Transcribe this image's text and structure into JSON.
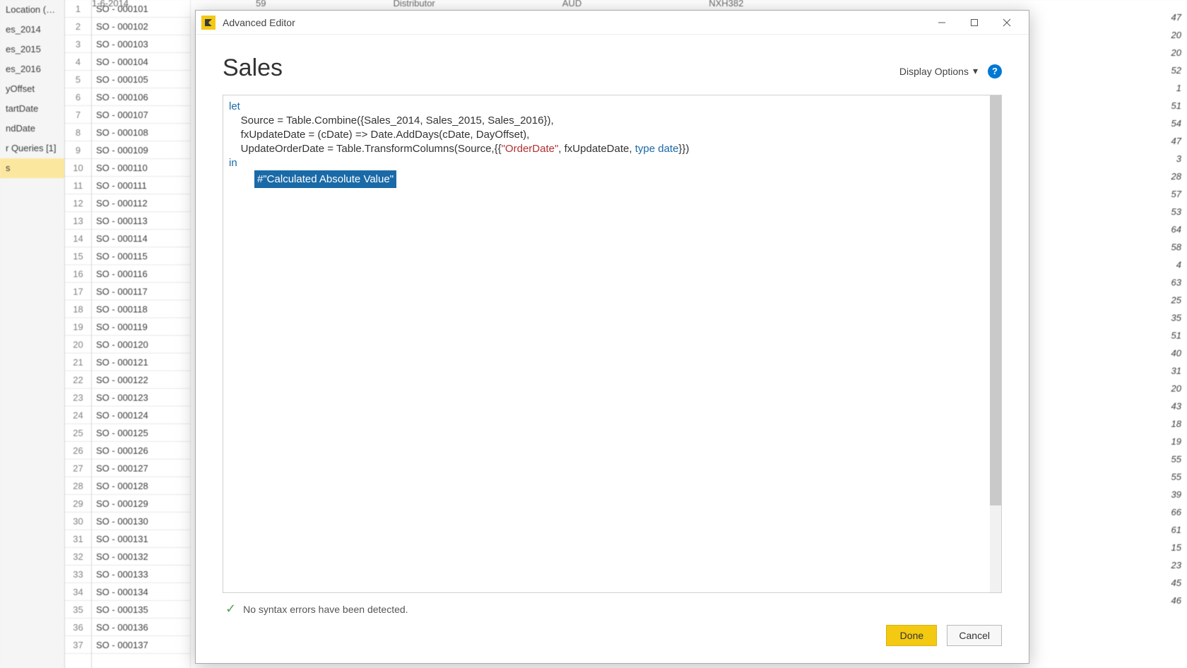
{
  "bg": {
    "queries": [
      "Location (C:\\…",
      "es_2014",
      "es_2015",
      "es_2016",
      "yOffset",
      "tartDate",
      "ndDate",
      "r Queries [1]",
      "s"
    ],
    "header_cells": [
      "1-6-2014",
      "59",
      "Distributor",
      "AUD",
      "NXH382"
    ],
    "rows": [
      {
        "n": 1,
        "so": "SO - 000101",
        "r": 47
      },
      {
        "n": 2,
        "so": "SO - 000102",
        "r": 20
      },
      {
        "n": 3,
        "so": "SO - 000103",
        "r": 20
      },
      {
        "n": 4,
        "so": "SO - 000104",
        "r": 52
      },
      {
        "n": 5,
        "so": "SO - 000105",
        "r": 1
      },
      {
        "n": 6,
        "so": "SO - 000106",
        "r": 51
      },
      {
        "n": 7,
        "so": "SO - 000107",
        "r": 54
      },
      {
        "n": 8,
        "so": "SO - 000108",
        "r": 47
      },
      {
        "n": 9,
        "so": "SO - 000109",
        "r": 3
      },
      {
        "n": 10,
        "so": "SO - 000110",
        "r": 28
      },
      {
        "n": 11,
        "so": "SO - 000111",
        "r": 57
      },
      {
        "n": 12,
        "so": "SO - 000112",
        "r": 53
      },
      {
        "n": 13,
        "so": "SO - 000113",
        "r": 64
      },
      {
        "n": 14,
        "so": "SO - 000114",
        "r": 58
      },
      {
        "n": 15,
        "so": "SO - 000115",
        "r": 4
      },
      {
        "n": 16,
        "so": "SO - 000116",
        "r": 63
      },
      {
        "n": 17,
        "so": "SO - 000117",
        "r": 25
      },
      {
        "n": 18,
        "so": "SO - 000118",
        "r": 35
      },
      {
        "n": 19,
        "so": "SO - 000119",
        "r": 51
      },
      {
        "n": 20,
        "so": "SO - 000120",
        "r": 40
      },
      {
        "n": 21,
        "so": "SO - 000121",
        "r": 31
      },
      {
        "n": 22,
        "so": "SO - 000122",
        "r": 20
      },
      {
        "n": 23,
        "so": "SO - 000123",
        "r": 43
      },
      {
        "n": 24,
        "so": "SO - 000124",
        "r": 18
      },
      {
        "n": 25,
        "so": "SO - 000125",
        "r": 19
      },
      {
        "n": 26,
        "so": "SO - 000126",
        "r": 55
      },
      {
        "n": 27,
        "so": "SO - 000127",
        "r": 55
      },
      {
        "n": 28,
        "so": "SO - 000128",
        "r": 39
      },
      {
        "n": 29,
        "so": "SO - 000129",
        "r": 66
      },
      {
        "n": 30,
        "so": "SO - 000130",
        "r": 61
      },
      {
        "n": 31,
        "so": "SO - 000131",
        "r": 15
      },
      {
        "n": 32,
        "so": "SO - 000132",
        "r": 23
      },
      {
        "n": 33,
        "so": "SO - 000133",
        "r": 45
      },
      {
        "n": 34,
        "so": "SO - 000134",
        "r": 46
      },
      {
        "n": 35,
        "so": "SO - 000135",
        "r": ""
      },
      {
        "n": 36,
        "so": "SO - 000136",
        "r": ""
      },
      {
        "n": 37,
        "so": "SO - 000137",
        "r": ""
      }
    ]
  },
  "dialog": {
    "title": "Advanced Editor",
    "query_name": "Sales",
    "display_options_label": "Display Options",
    "help_tooltip": "?",
    "code": {
      "let_kw": "let",
      "line1_a": "    Source = Table.Combine({Sales_2014, Sales_2015, Sales_2016}),",
      "line2_a": "    fxUpdateDate = (cDate) => Date.AddDays(cDate, DayOffset),",
      "line3_a": "    UpdateOrderDate = Table.TransformColumns(Source,{{",
      "line3_str": "\"OrderDate\"",
      "line3_b": ", fxUpdateDate, ",
      "line3_type": "type date",
      "line3_c": "}})",
      "in_kw": "in",
      "selected": "#\"Calculated Absolute Value\""
    },
    "status": "No syntax errors have been detected.",
    "done_label": "Done",
    "cancel_label": "Cancel"
  }
}
